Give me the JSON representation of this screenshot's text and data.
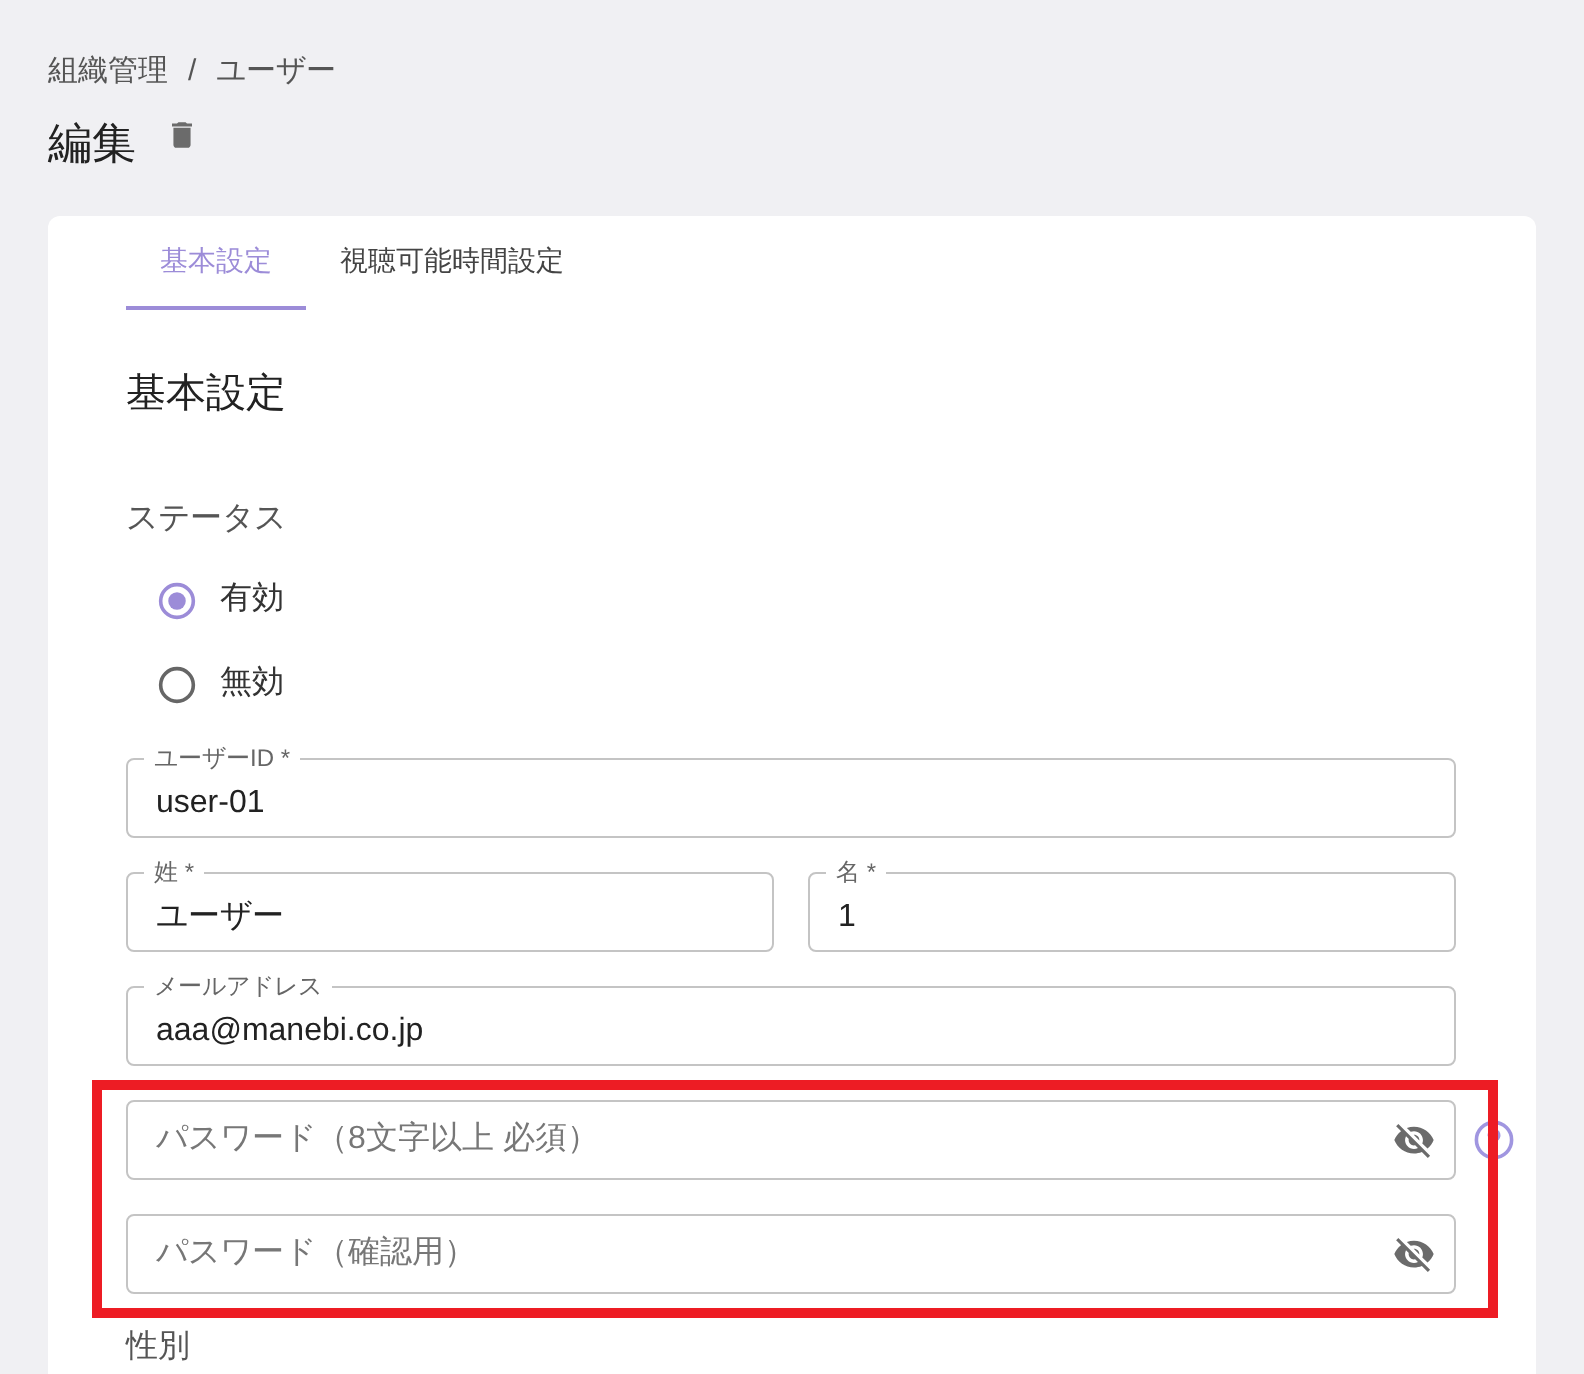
{
  "breadcrumb": {
    "items": [
      "組織管理",
      "ユーザー"
    ],
    "separator": "/"
  },
  "page": {
    "title": "編集"
  },
  "tabs": [
    {
      "label": "基本設定",
      "selected": true
    },
    {
      "label": "視聴可能時間設定",
      "selected": false
    }
  ],
  "section": {
    "title": "基本設定",
    "status": {
      "label": "ステータス",
      "options": [
        {
          "label": "有効",
          "selected": true
        },
        {
          "label": "無効",
          "selected": false
        }
      ]
    }
  },
  "field_rows": [
    {
      "fields": [
        {
          "label": "ユーザーID *",
          "value": "user-01"
        }
      ]
    },
    {
      "fields": [
        {
          "label": "姓 *",
          "value": "ユーザー"
        },
        {
          "label": "名 *",
          "value": "1"
        }
      ]
    },
    {
      "fields": [
        {
          "label": "メールアドレス",
          "value": "aaa@manebi.co.jp"
        }
      ]
    }
  ],
  "password_group": {
    "highlighted": true,
    "fields": [
      {
        "placeholder": "パスワード（8文字以上 必須）",
        "revealed": false,
        "help": true
      },
      {
        "placeholder": "パスワード（確認用）",
        "revealed": false,
        "help": false
      }
    ]
  },
  "gender": {
    "label": "性別"
  }
}
